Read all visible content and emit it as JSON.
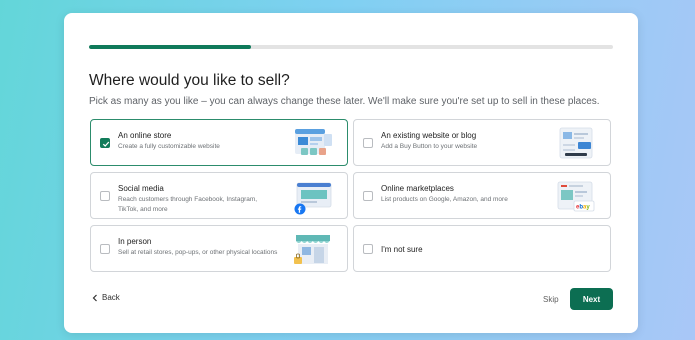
{
  "progress": {
    "fraction": 0.31
  },
  "header": {
    "title": "Where would you like to sell?",
    "subtitle": "Pick as many as you like – you can always change these later. We'll make sure you're set up to sell in these places."
  },
  "options": [
    {
      "title": "An online store",
      "desc": "Create a fully customizable website",
      "checked": true,
      "illustration": "online-store-illustration"
    },
    {
      "title": "An existing website or blog",
      "desc": "Add a Buy Button to your website",
      "checked": false,
      "illustration": "website-blog-illustration"
    },
    {
      "title": "Social media",
      "desc": "Reach customers through Facebook, Instagram, TikTok, and more",
      "checked": false,
      "illustration": "social-media-illustration"
    },
    {
      "title": "Online marketplaces",
      "desc": "List products on Google, Amazon, and more",
      "checked": false,
      "illustration": "marketplaces-illustration"
    },
    {
      "title": "In person",
      "desc": "Sell at retail stores, pop-ups, or other physical locations",
      "checked": false,
      "illustration": "storefront-illustration"
    },
    {
      "title": "I'm not sure",
      "desc": "",
      "checked": false,
      "illustration": ""
    }
  ],
  "footer": {
    "back_label": "Back",
    "skip_label": "Skip",
    "next_label": "Next"
  },
  "colors": {
    "accent": "#0c6e52",
    "progress": "#0f7a5a",
    "border_selected": "#2c8c6c"
  }
}
